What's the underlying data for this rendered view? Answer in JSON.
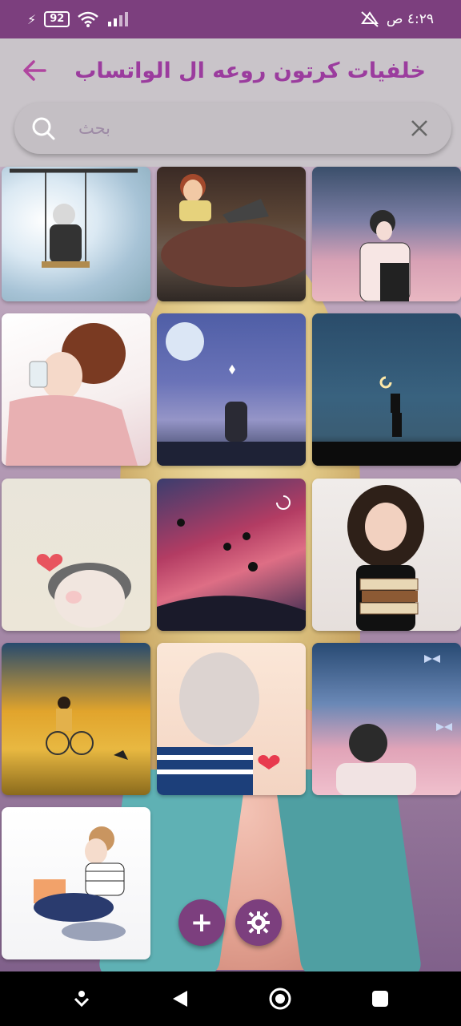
{
  "statusbar": {
    "time": "٤:٢٩ ص",
    "battery": "92"
  },
  "appbar": {
    "title": "خلفيات كرتون روعه ال الواتساب"
  },
  "search": {
    "placeholder": "بحث",
    "value": ""
  },
  "grid": {
    "items": [
      {
        "subject": "girl on swing"
      },
      {
        "subject": "girl with laptop in bed"
      },
      {
        "subject": "girl on pink starry sky"
      },
      {
        "subject": "girl drinking from cup"
      },
      {
        "subject": "girl reaching to moon"
      },
      {
        "subject": "girl silhouette holding moon"
      },
      {
        "subject": "girl with heart"
      },
      {
        "subject": "girl with balloons on galaxy"
      },
      {
        "subject": "girl with glasses holding books"
      },
      {
        "subject": "girl on bicycle"
      },
      {
        "subject": "braided hair girl with heart"
      },
      {
        "subject": "girl under butterflies"
      },
      {
        "subject": "girl reading on chair"
      }
    ]
  },
  "fabs": {
    "add": "+",
    "settings": "settings"
  },
  "colors": {
    "accent": "#7c3f7e",
    "title": "#9b3c9e"
  }
}
